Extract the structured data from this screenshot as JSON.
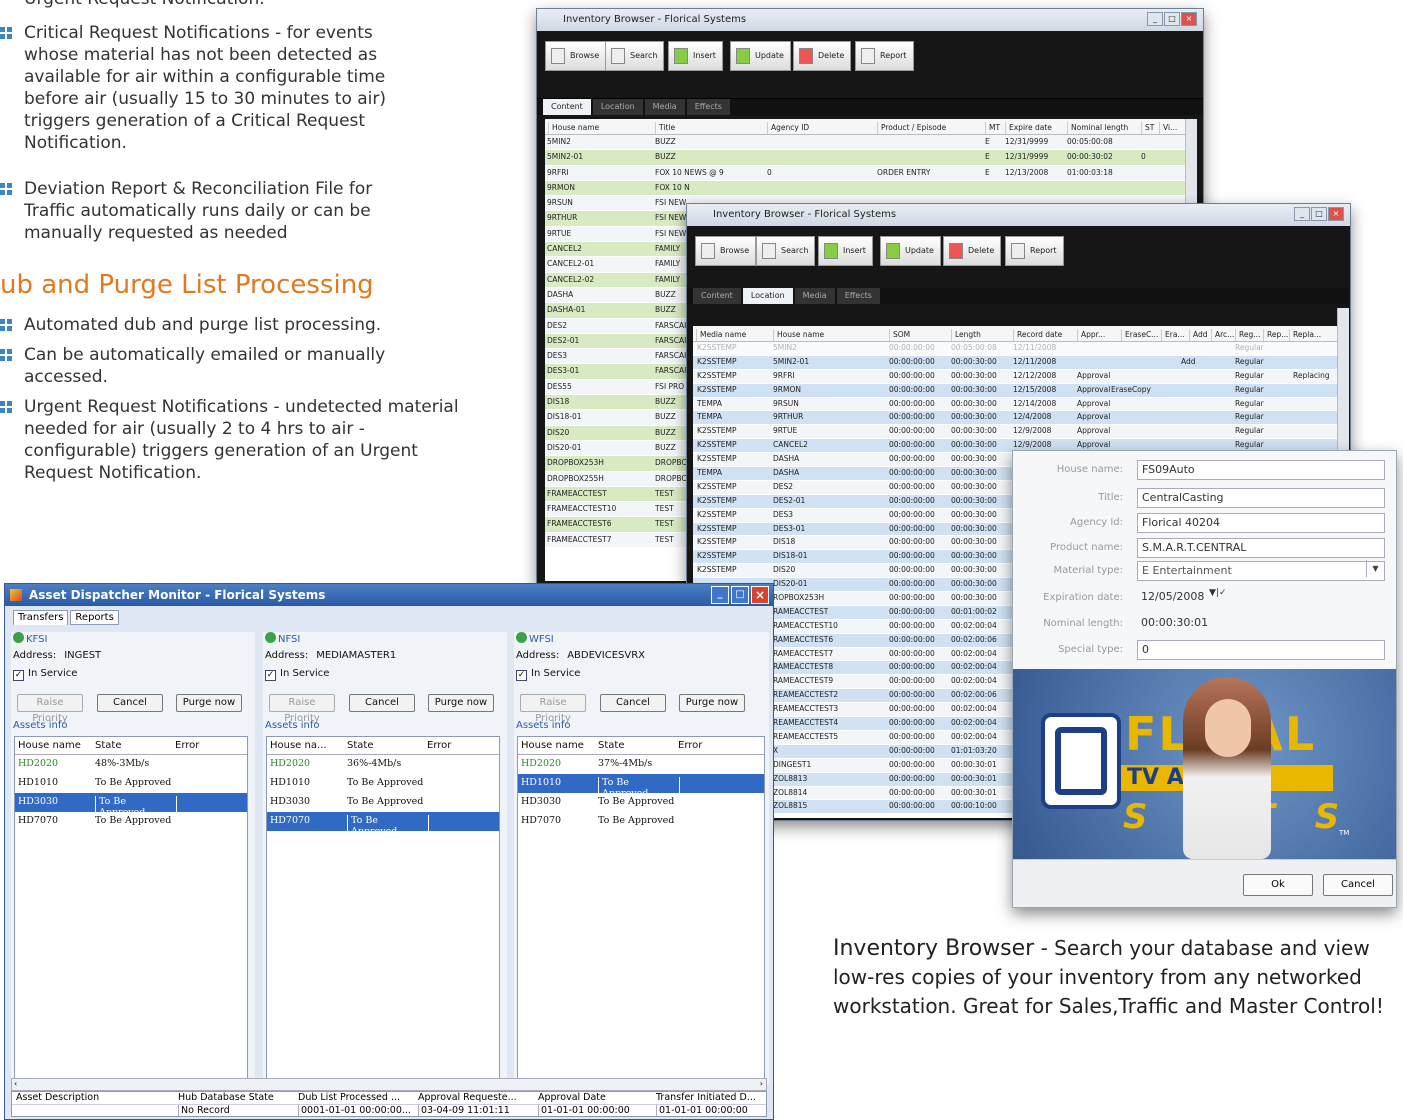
{
  "left_text": {
    "top_line": "Urgent Request Notification.",
    "bullets1": [
      "Critical Request Notifications - for events whose material has not been detected as available for air within a configurable time before air (usually 15 to 30 minutes to air) triggers generation of a Critical Request Notification.",
      "Deviation Report & Reconciliation File for Traffic automatically runs daily or can be manually requested as needed"
    ],
    "heading": "ub and Purge List Processing",
    "bullets2": [
      "Automated dub and purge list processing.",
      "Can be automatically emailed or manually accessed.",
      "Urgent Request Notifications - undetected material needed for air (usually 2 to 4 hrs to air - configurable) triggers generation of an Urgent Request Notification."
    ]
  },
  "ib1": {
    "title": "Inventory Browser - Florical Systems",
    "toolbar": [
      "Browse",
      "Search",
      "Insert",
      "Update",
      "Delete",
      "Report"
    ],
    "tabs": [
      "Content",
      "Location",
      "Media",
      "Effects"
    ],
    "headers": [
      "House name",
      "Title",
      "Agency ID",
      "Product / Episode",
      "MT",
      "Expire date",
      "Nominal length",
      "ST",
      "Vi..."
    ],
    "rows": [
      [
        "5MIN2",
        "BUZZ",
        "",
        "",
        "E",
        "12/31/9999",
        "00:05:00:08",
        ""
      ],
      [
        "5MIN2-01",
        "BUZZ",
        "",
        "",
        "E",
        "12/31/9999",
        "00:00:30:02",
        "0"
      ],
      [
        "9RFRI",
        "FOX 10 NEWS @ 9",
        "0",
        "ORDER ENTRY",
        "E",
        "12/13/2008",
        "01:00:03:18",
        ""
      ],
      [
        "9RMON",
        "FOX 10 N",
        "",
        "",
        "",
        "",
        "",
        ""
      ],
      [
        "9RSUN",
        "FSI NEW",
        "",
        "",
        "",
        "",
        "",
        ""
      ],
      [
        "9RTHUR",
        "FSI NEW",
        "",
        "",
        "",
        "",
        "",
        ""
      ],
      [
        "9RTUE",
        "FSI NEW",
        "",
        "",
        "",
        "",
        "",
        ""
      ],
      [
        "CANCEL2",
        "FAMILY",
        "",
        "",
        "",
        "",
        "",
        ""
      ],
      [
        "CANCEL2-01",
        "FAMILY",
        "",
        "",
        "",
        "",
        "",
        ""
      ],
      [
        "CANCEL2-02",
        "FAMILY",
        "",
        "",
        "",
        "",
        "",
        ""
      ],
      [
        "DASHA",
        "BUZZ",
        "",
        "",
        "",
        "",
        "",
        ""
      ],
      [
        "DASHA-01",
        "BUZZ",
        "",
        "",
        "",
        "",
        "",
        ""
      ],
      [
        "DES2",
        "FARSCAI",
        "",
        "",
        "",
        "",
        "",
        ""
      ],
      [
        "DES2-01",
        "FARSCAI",
        "",
        "",
        "",
        "",
        "",
        ""
      ],
      [
        "DES3",
        "FARSCAI",
        "",
        "",
        "",
        "",
        "",
        ""
      ],
      [
        "DES3-01",
        "FARSCAI",
        "",
        "",
        "",
        "",
        "",
        ""
      ],
      [
        "DES55",
        "FSI PRO",
        "",
        "",
        "",
        "",
        "",
        ""
      ],
      [
        "DIS18",
        "BUZZ",
        "",
        "",
        "",
        "",
        "",
        ""
      ],
      [
        "DIS18-01",
        "BUZZ",
        "",
        "",
        "",
        "",
        "",
        ""
      ],
      [
        "DIS20",
        "BUZZ",
        "",
        "",
        "",
        "",
        "",
        ""
      ],
      [
        "DIS20-01",
        "BUZZ",
        "",
        "",
        "",
        "",
        "",
        ""
      ],
      [
        "DROPBOX253H",
        "DROPBC",
        "",
        "",
        "",
        "",
        "",
        ""
      ],
      [
        "DROPBOX255H",
        "DROPBC",
        "",
        "",
        "",
        "",
        "",
        ""
      ],
      [
        "FRAMEACCTEST",
        "TEST",
        "",
        "",
        "",
        "",
        "",
        ""
      ],
      [
        "FRAMEACCTEST10",
        "TEST",
        "",
        "",
        "",
        "",
        "",
        ""
      ],
      [
        "FRAMEACCTEST6",
        "TEST",
        "",
        "",
        "",
        "",
        "",
        ""
      ],
      [
        "FRAMEACCTEST7",
        "TEST",
        "",
        "",
        "",
        "",
        "",
        ""
      ]
    ]
  },
  "ib2": {
    "title": "Inventory Browser - Florical Systems",
    "toolbar": [
      "Browse",
      "Search",
      "Insert",
      "Update",
      "Delete",
      "Report"
    ],
    "tabs": [
      "Content",
      "Location",
      "Media",
      "Effects"
    ],
    "headers": [
      "Media name",
      "House name",
      "SOM",
      "Length",
      "Record date",
      "Appr...",
      "EraseC...",
      "Era...",
      "Add",
      "Arc...",
      "Reg...",
      "Rep...",
      "Repla..."
    ],
    "rows": [
      [
        "K2SSTEMP",
        "5MIN2",
        "00:00:00:00",
        "00:05:00:08",
        "12/11/2008",
        "",
        "",
        "",
        "",
        "Regular",
        ""
      ],
      [
        "K2SSTEMP",
        "5MIN2-01",
        "00:00:00:00",
        "00:00:30:00",
        "12/11/2008",
        "",
        "",
        "Add",
        "",
        "Regular",
        ""
      ],
      [
        "K2SSTEMP",
        "9RFRI",
        "00:00:00:00",
        "00:00:30:00",
        "12/12/2008",
        "Approval",
        "",
        "",
        "",
        "Regular",
        "Replacing"
      ],
      [
        "K2SSTEMP",
        "9RMON",
        "00:00:00:00",
        "00:00:30:00",
        "12/15/2008",
        "Approval",
        "EraseCopy",
        "",
        "",
        "Regular",
        ""
      ],
      [
        "TEMPA",
        "9RSUN",
        "00:00:00:00",
        "00:00:30:00",
        "12/14/2008",
        "Approval",
        "",
        "",
        "",
        "Regular",
        ""
      ],
      [
        "TEMPA",
        "9RTHUR",
        "00:00:00:00",
        "00:00:30:00",
        "12/4/2008",
        "Approval",
        "",
        "",
        "",
        "Regular",
        ""
      ],
      [
        "K2SSTEMP",
        "9RTUE",
        "00:00:00:00",
        "00:00:30:00",
        "12/9/2008",
        "Approval",
        "",
        "",
        "",
        "Regular",
        ""
      ],
      [
        "K2SSTEMP",
        "CANCEL2",
        "00:00:00:00",
        "00:00:30:00",
        "12/9/2008",
        "Approval",
        "",
        "",
        "",
        "Regular",
        ""
      ],
      [
        "K2SSTEMP",
        "DASHA",
        "00:00:00:00",
        "00:00:30:00",
        "",
        "",
        "",
        "",
        "",
        "",
        ""
      ],
      [
        "TEMPA",
        "DASHA",
        "00:00:00:00",
        "00:00:30:00",
        "",
        "",
        "",
        "",
        "",
        "",
        ""
      ],
      [
        "K2SSTEMP",
        "DES2",
        "00:00:00:00",
        "00:00:30:00",
        "",
        "",
        "",
        "",
        "",
        "",
        ""
      ],
      [
        "K2SSTEMP",
        "DES2-01",
        "00:00:00:00",
        "00:00:30:00",
        "",
        "",
        "",
        "",
        "",
        "",
        ""
      ],
      [
        "K2SSTEMP",
        "DES3",
        "00:00:00:00",
        "00:00:30:00",
        "",
        "",
        "",
        "",
        "",
        "",
        ""
      ],
      [
        "K2SSTEMP",
        "DES3-01",
        "00:00:00:00",
        "00:00:30:00",
        "",
        "",
        "",
        "",
        "",
        "",
        ""
      ],
      [
        "K2SSTEMP",
        "DIS18",
        "00:00:00:00",
        "00:00:30:00",
        "",
        "",
        "",
        "",
        "",
        "",
        ""
      ],
      [
        "K2SSTEMP",
        "DIS18-01",
        "00:00:00:00",
        "00:00:30:00",
        "",
        "",
        "",
        "",
        "",
        "",
        ""
      ],
      [
        "K2SSTEMP",
        "DIS20",
        "00:00:00:00",
        "00:00:30:00",
        "",
        "",
        "",
        "",
        "",
        "",
        ""
      ],
      [
        "",
        "DIS20-01",
        "00:00:00:00",
        "00:00:30:00",
        "",
        "",
        "",
        "",
        "",
        "",
        ""
      ],
      [
        "",
        "ROPBOX253H",
        "00:00:00:00",
        "00:00:30:00",
        "",
        "",
        "",
        "",
        "",
        "",
        ""
      ],
      [
        "",
        "RAMEACCTEST",
        "00:00:00:00",
        "00:01:00:02",
        "",
        "",
        "",
        "",
        "",
        "",
        ""
      ],
      [
        "",
        "RAMEACCTEST10",
        "00:00:00:00",
        "00:02:00:04",
        "",
        "",
        "",
        "",
        "",
        "",
        ""
      ],
      [
        "",
        "RAMEACCTEST6",
        "00:00:00:00",
        "00:02:00:06",
        "",
        "",
        "",
        "",
        "",
        "",
        ""
      ],
      [
        "",
        "RAMEACCTEST7",
        "00:00:00:00",
        "00:02:00:04",
        "",
        "",
        "",
        "",
        "",
        "",
        ""
      ],
      [
        "",
        "RAMEACCTEST8",
        "00:00:00:00",
        "00:02:00:04",
        "",
        "",
        "",
        "",
        "",
        "",
        ""
      ],
      [
        "",
        "RAMEACCTEST9",
        "00:00:00:00",
        "00:02:00:04",
        "",
        "",
        "",
        "",
        "",
        "",
        ""
      ],
      [
        "",
        "REAMEACCTEST2",
        "00:00:00:00",
        "00:02:00:06",
        "",
        "",
        "",
        "",
        "",
        "",
        ""
      ],
      [
        "",
        "REAMEACCTEST3",
        "00:00:00:00",
        "00:02:00:04",
        "",
        "",
        "",
        "",
        "",
        "",
        ""
      ],
      [
        "",
        "REAMEACCTEST4",
        "00:00:00:00",
        "00:02:00:04",
        "",
        "",
        "",
        "",
        "",
        "",
        ""
      ],
      [
        "",
        "REAMEACCTEST5",
        "00:00:00:00",
        "00:02:00:04",
        "",
        "",
        "",
        "",
        "",
        "",
        ""
      ],
      [
        "",
        "X",
        "00:00:00:00",
        "01:01:03:20",
        "",
        "",
        "",
        "",
        "",
        "",
        ""
      ],
      [
        "",
        "DINGEST1",
        "00:00:00:00",
        "00:00:30:01",
        "",
        "",
        "",
        "",
        "",
        "",
        ""
      ],
      [
        "",
        "ZOL8813",
        "00:00:00:00",
        "00:00:30:01",
        "",
        "",
        "",
        "",
        "",
        "",
        ""
      ],
      [
        "",
        "ZOL8814",
        "00:00:00:00",
        "00:00:30:01",
        "",
        "",
        "",
        "",
        "",
        "",
        ""
      ],
      [
        "",
        "ZOL8815",
        "00:00:00:00",
        "00:00:10:00",
        "",
        "",
        "",
        "",
        "",
        "",
        ""
      ]
    ]
  },
  "dialog": {
    "fields": [
      {
        "label": "House name:",
        "value": "FS09Auto"
      },
      {
        "label": "Title:",
        "value": "CentralCasting"
      },
      {
        "label": "Agency Id:",
        "value": "Florical 40204"
      },
      {
        "label": "Product name:",
        "value": "S.M.A.R.T.CENTRAL"
      },
      {
        "label": "Material type:",
        "value": "E      Entertainment"
      },
      {
        "label": "Expiration date:",
        "value": "12/05/2008"
      },
      {
        "label": "Nominal length:",
        "value": "00:00:30:01"
      },
      {
        "label": "Special type:",
        "value": "0"
      }
    ],
    "logo": {
      "line1": "FLO  AL",
      "line2": "TV AUT    ION",
      "line3": "S Y  T  S",
      "tm": "TM"
    },
    "ok": "Ok",
    "cancel": "Cancel"
  },
  "adm": {
    "title": "Asset Dispatcher Monitor - Florical Systems",
    "tabs": [
      "Transfers",
      "Reports"
    ],
    "panels": [
      {
        "name": "KFSI",
        "address_label": "Address:",
        "address": "INGEST",
        "in_service": "In Service",
        "buttons": [
          "Raise Priority",
          "Cancel",
          "Purge now"
        ],
        "assets_info": "Assets info",
        "headers": [
          "House name",
          "State",
          "Error"
        ],
        "rows": [
          [
            "HD2020",
            "48%-3Mb/s"
          ],
          [
            "HD1010",
            "To Be Approved"
          ],
          [
            "HD3030",
            "To Be Approved"
          ],
          [
            "HD7070",
            "To Be Approved"
          ]
        ],
        "selected_index": 2
      },
      {
        "name": "NFSI",
        "address_label": "Address:",
        "address": "MEDIAMASTER1",
        "in_service": "In Service",
        "buttons": [
          "Raise Priority",
          "Cancel",
          "Purge now"
        ],
        "assets_info": "Assets info",
        "headers": [
          "House na...",
          "State",
          "Error"
        ],
        "rows": [
          [
            "HD2020",
            "36%-4Mb/s"
          ],
          [
            "HD1010",
            "To Be Approved"
          ],
          [
            "HD3030",
            "To Be Approved"
          ],
          [
            "HD7070",
            "To Be Approved"
          ]
        ],
        "selected_index": 3
      },
      {
        "name": "WFSI",
        "address_label": "Address:",
        "address": "ABDEVICESVRX",
        "in_service": "In Service",
        "buttons": [
          "Raise Priority",
          "Cancel",
          "Purge now"
        ],
        "assets_info": "Assets info",
        "headers": [
          "House name",
          "State",
          "Error"
        ],
        "rows": [
          [
            "HD2020",
            "37%-4Mb/s"
          ],
          [
            "HD1010",
            "To Be Approved"
          ],
          [
            "HD3030",
            "To Be Approved"
          ],
          [
            "HD7070",
            "To Be Approved"
          ]
        ],
        "selected_index": 1
      }
    ],
    "bottom_headers": [
      "Asset Description",
      "Hub Database State",
      "Dub List Processed ...",
      "Approval Requeste...",
      "Approval Date",
      "Transfer Initiated D..."
    ],
    "bottom_row": [
      "",
      "No Record",
      "0001-01-01 00:00:00...",
      "03-04-09 11:01:11",
      "01-01-01 00:00:00",
      "01-01-01 00:00:00"
    ]
  },
  "caption": {
    "title": "Inventory Browser",
    "body": " - Search your database and view low-res copies of your inventory from any networked workstation.  Great for Sales,Traffic and Master Control!"
  },
  "colors": {
    "accent_orange": "#e07a1f",
    "bullet_blue": "#3a86c8",
    "row_green": "#d8eac2",
    "row_blue": "#cfe1f2",
    "select_blue": "#316ac5",
    "asset_green": "#2a8a2a"
  }
}
